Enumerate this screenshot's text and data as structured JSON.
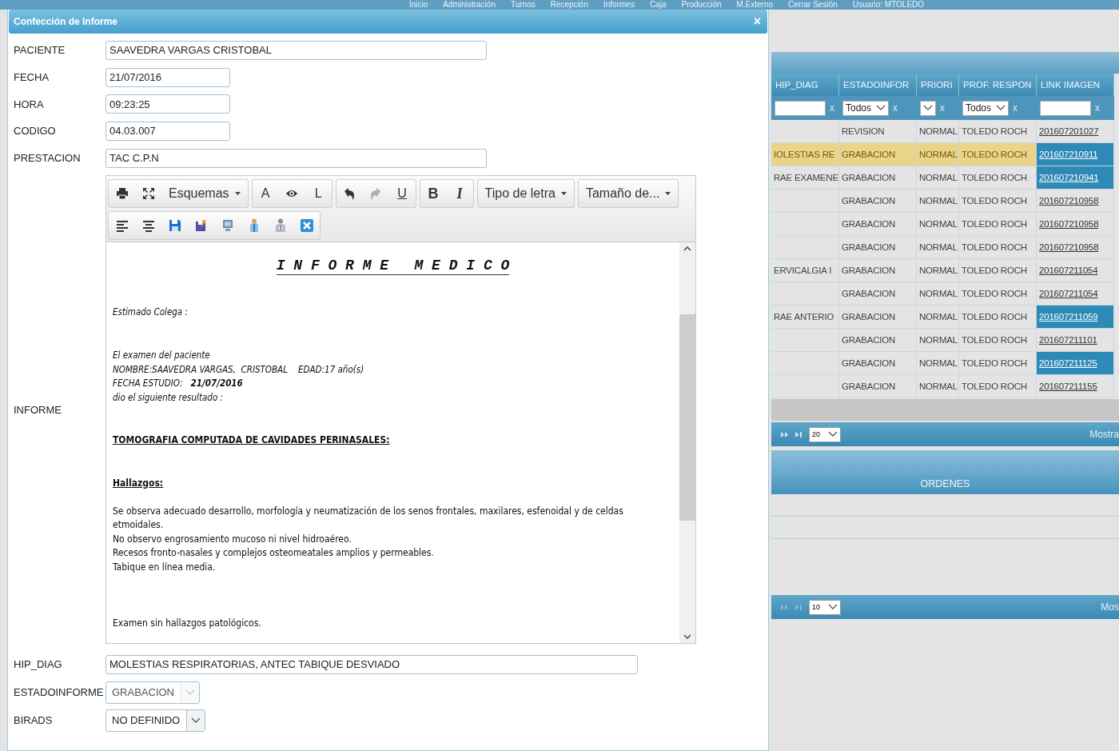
{
  "top_nav": [
    "Inicio",
    "Administración",
    "Turnos",
    "Recepción",
    "Informes",
    "Caja",
    "Producción",
    "M.Externo",
    "Cerrar Sesión",
    "Usuario: MTOLEDO"
  ],
  "dialog": {
    "title": "Confección de Informe",
    "close": "×",
    "fields": [
      {
        "label": "PACIENTE",
        "value": "SAAVEDRA VARGAS CRISTOBAL"
      },
      {
        "label": "FECHA",
        "value": "21/07/2016"
      },
      {
        "label": "HORA",
        "value": "09:23:25"
      },
      {
        "label": "CODIGO",
        "value": "04.03.007"
      },
      {
        "label": "PRESTACION",
        "value": "TAC C.P.N"
      }
    ],
    "editor": {
      "label": "INFORME",
      "toolbar": [
        [
          {
            "kind": "print",
            "disabled": false
          },
          {
            "kind": "fullscreen",
            "disabled": false
          },
          {
            "kind": "dropdown",
            "label": "Esquemas",
            "disabled": false
          }
        ],
        [
          {
            "kind": "letter",
            "label": "A",
            "disabled": false
          },
          {
            "kind": "eye",
            "disabled": false
          },
          {
            "kind": "letter",
            "label": "L",
            "disabled": false
          }
        ],
        [
          {
            "kind": "undo",
            "disabled": false
          },
          {
            "kind": "redo",
            "disabled": true
          },
          {
            "kind": "underline",
            "label": "U",
            "disabled": false
          }
        ],
        [
          {
            "kind": "bold",
            "label": "B",
            "disabled": false
          },
          {
            "kind": "italic",
            "label": "I",
            "disabled": false
          }
        ],
        [
          {
            "kind": "dropdown",
            "label": "Tipo de letra",
            "disabled": false
          }
        ],
        [
          {
            "kind": "dropdown",
            "label": "Tamaño de...",
            "disabled": false
          }
        ]
      ],
      "toolbar_row2": [
        [
          {
            "kind": "align-left",
            "disabled": false
          },
          {
            "kind": "align-center",
            "disabled": false
          },
          {
            "kind": "save",
            "disabled": false
          },
          {
            "kind": "save-as",
            "disabled": false
          },
          {
            "kind": "monitor",
            "disabled": false
          },
          {
            "kind": "doctor",
            "disabled": false
          },
          {
            "kind": "patient",
            "disabled": false
          },
          {
            "kind": "close",
            "disabled": false
          }
        ]
      ],
      "blocks": [
        {
          "kind": "title",
          "lines": [
            "I N F O R M E   M E D I C O"
          ]
        },
        {
          "kind": "italic",
          "lines": [
            "Estimado Colega :"
          ]
        },
        {
          "kind": "italic",
          "lines": [
            "El examen del paciente",
            "NOMBRE:SAAVEDRA VARGAS,  CRISTOBAL    EDAD:17 año(s)",
            "FECHA ESTUDIO:   **21/07/2016**",
            "dio el siguiente resultado :"
          ]
        },
        {
          "kind": "heading",
          "lines": [
            "TOMOGRAFIA COMPUTADA DE CAVIDADES PERINASALES:"
          ]
        },
        {
          "kind": "heading",
          "lines": [
            "Hallazgos:"
          ]
        },
        {
          "kind": "text",
          "lines": [
            "Se observa adecuado desarrollo, morfología y neumatización de los senos frontales, maxilares, esfenoidal y de celdas etmoidales.",
            "No observo engrosamiento mucoso ni nivel hidroaéreo.",
            "Recesos fronto-nasales y complejos osteomeatales amplios y permeables.",
            "Tabique en línea media."
          ]
        },
        {
          "kind": "text",
          "lines": [
            "Examen sin hallazgos patológicos."
          ]
        }
      ]
    },
    "bottom_fields": [
      {
        "kind": "input",
        "label": "HIP_DIAG",
        "value": "MOLESTIAS RESPIRATORIAS, ANTEC TABIQUE DESVIADO",
        "disabled": false
      },
      {
        "kind": "select",
        "label": "ESTADOINFORME",
        "value": "GRABACION",
        "disabled": true
      },
      {
        "kind": "select",
        "label": "BIRADS",
        "value": "NO DEFINIDO",
        "disabled": false
      }
    ]
  },
  "grid": {
    "columns": [
      "HIP_DIAG",
      "ESTADOINFOR",
      "PRIORI",
      "PROF. RESPON",
      "LINK IMAGEN"
    ],
    "filters": [
      {
        "kind": "input",
        "clear": "x"
      },
      {
        "kind": "select",
        "value": "Todos",
        "clear": "x"
      },
      {
        "kind": "select",
        "clear": "x"
      },
      {
        "kind": "select",
        "value": "Todos",
        "clear": "x"
      },
      {
        "kind": "input",
        "clear": "x"
      }
    ],
    "rows": [
      {
        "selected": false,
        "cells": [
          "",
          "REVISION",
          "NORMAL",
          "TOLEDO ROCH",
          "201607201027"
        ],
        "link_highlighted": false
      },
      {
        "selected": true,
        "cells": [
          "IOLESTIAS RE",
          "GRABACION",
          "NORMAL",
          "TOLEDO ROCH",
          "201607210911"
        ],
        "link_highlighted": true
      },
      {
        "selected": false,
        "cells": [
          "RAE EXAMENE",
          "GRABACION",
          "NORMAL",
          "TOLEDO ROCH",
          "201607210941"
        ],
        "link_highlighted": true
      },
      {
        "selected": false,
        "cells": [
          "",
          "GRABACION",
          "NORMAL",
          "TOLEDO ROCH",
          "201607210958"
        ],
        "link_highlighted": false
      },
      {
        "selected": false,
        "cells": [
          "",
          "GRABACION",
          "NORMAL",
          "TOLEDO ROCH",
          "201607210958"
        ],
        "link_highlighted": false
      },
      {
        "selected": false,
        "cells": [
          "",
          "GRABACION",
          "NORMAL",
          "TOLEDO ROCH",
          "201607210958"
        ],
        "link_highlighted": false
      },
      {
        "selected": false,
        "cells": [
          "ERVICALGIA I",
          "GRABACION",
          "NORMAL",
          "TOLEDO ROCH",
          "201607211054"
        ],
        "link_highlighted": false
      },
      {
        "selected": false,
        "cells": [
          "",
          "GRABACION",
          "NORMAL",
          "TOLEDO ROCH",
          "201607211054"
        ],
        "link_highlighted": false
      },
      {
        "selected": false,
        "cells": [
          "RAE ANTERIO",
          "GRABACION",
          "NORMAL",
          "TOLEDO ROCH",
          "201607211059"
        ],
        "link_highlighted": true
      },
      {
        "selected": false,
        "cells": [
          "",
          "GRABACION",
          "NORMAL",
          "TOLEDO ROCH",
          "201607211101"
        ],
        "link_highlighted": false
      },
      {
        "selected": false,
        "cells": [
          "",
          "GRABACION",
          "NORMAL",
          "TOLEDO ROCH",
          "201607211125"
        ],
        "link_highlighted": true
      },
      {
        "selected": false,
        "cells": [
          "",
          "GRABACION",
          "NORMAL",
          "TOLEDO ROCH",
          "201607211155"
        ],
        "link_highlighted": false
      }
    ],
    "pager": {
      "page_size": "20",
      "info": "Mostra"
    }
  },
  "orders": {
    "title": "ORDENES",
    "pager": {
      "page_size": "10",
      "info": "Mos"
    }
  }
}
